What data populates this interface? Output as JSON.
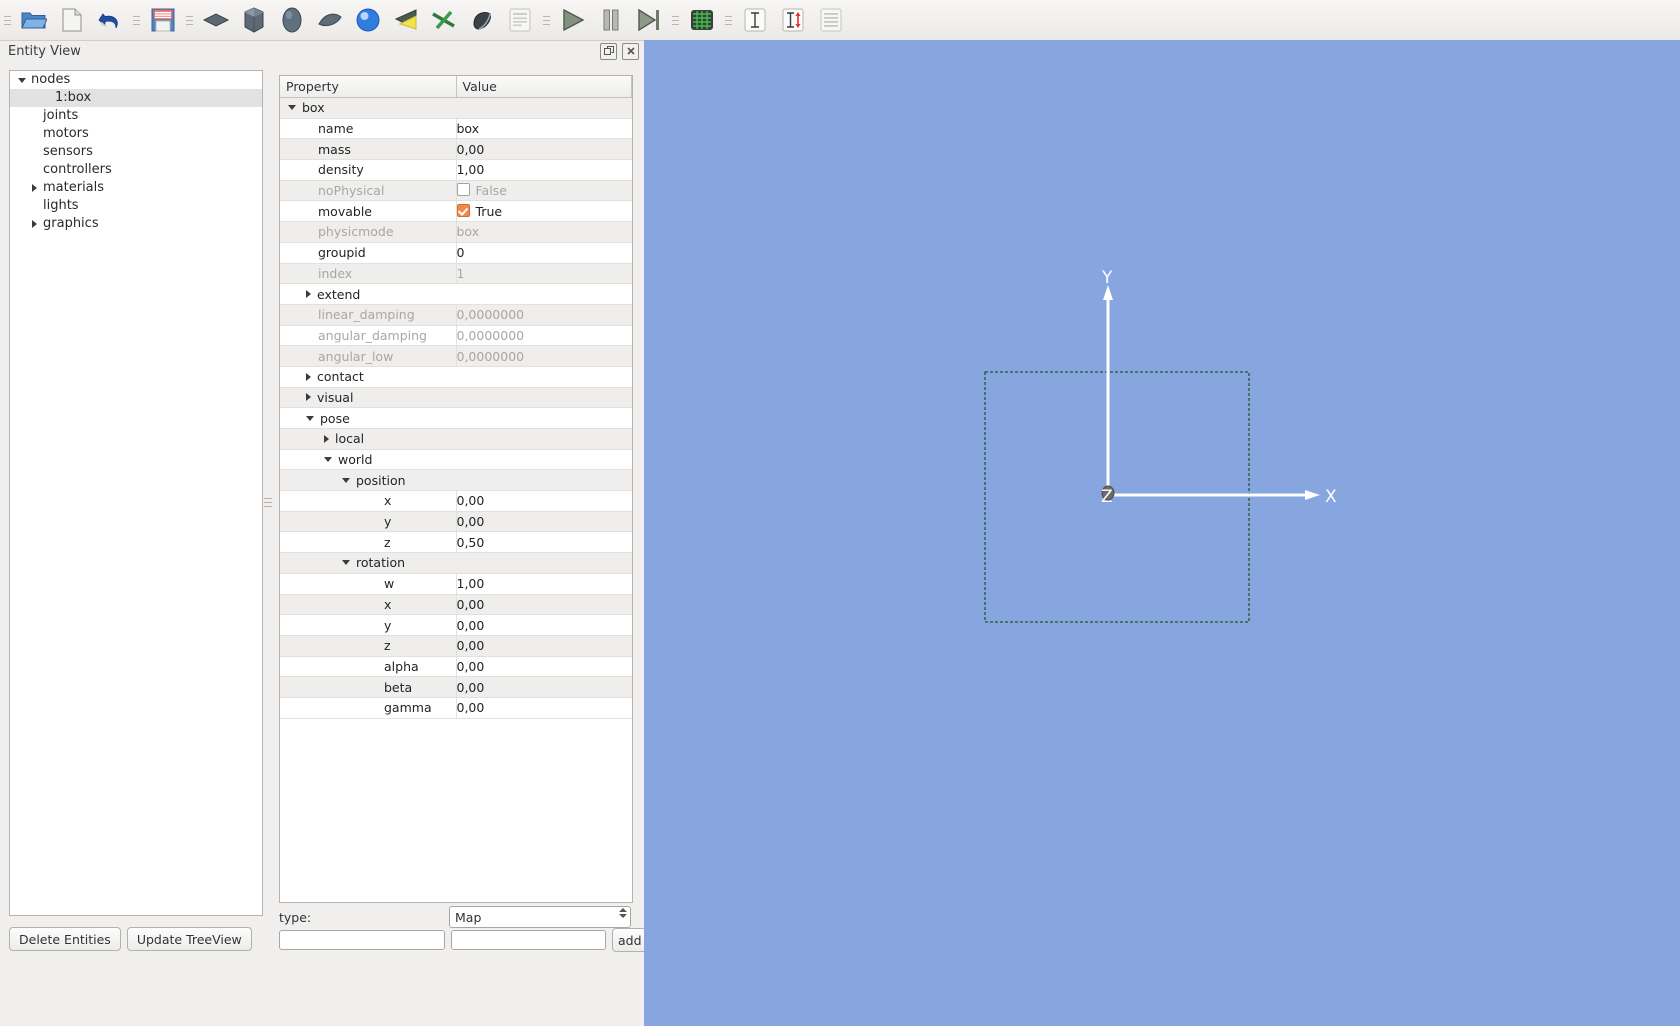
{
  "toolbar": {
    "items": [
      {
        "name": "separator",
        "icon": "separator-grip",
        "label": ""
      },
      {
        "name": "open-file-button",
        "icon": "folder-open-icon",
        "label": "Open"
      },
      {
        "name": "new-file-button",
        "icon": "new-document-icon",
        "label": "New"
      },
      {
        "name": "undo-button",
        "icon": "undo-arrow-icon",
        "label": "Undo"
      },
      {
        "name": "separator",
        "icon": "separator-grip",
        "label": ""
      },
      {
        "name": "save-button",
        "icon": "floppy-save-icon",
        "label": "Save"
      },
      {
        "name": "separator",
        "icon": "separator-grip",
        "label": ""
      },
      {
        "name": "add-plane-button",
        "icon": "plane-primitive-icon",
        "label": "Plane"
      },
      {
        "name": "add-box-button",
        "icon": "box-primitive-icon",
        "label": "Box"
      },
      {
        "name": "add-capsule-button",
        "icon": "capsule-primitive-icon",
        "label": "Capsule"
      },
      {
        "name": "add-cone-button",
        "icon": "cone-primitive-icon",
        "label": "Cone"
      },
      {
        "name": "add-sphere-button",
        "icon": "sphere-primitive-icon",
        "label": "Sphere"
      },
      {
        "name": "add-light-button",
        "icon": "light-cone-icon",
        "label": "Light"
      },
      {
        "name": "add-joint-button",
        "icon": "joint-cross-icon",
        "label": "Joint"
      },
      {
        "name": "add-mesh-button",
        "icon": "mesh-shape-icon",
        "label": "Mesh"
      },
      {
        "name": "document-button",
        "icon": "document-lines-icon",
        "label": "Document"
      },
      {
        "name": "separator",
        "icon": "separator-grip",
        "label": ""
      },
      {
        "name": "play-button",
        "icon": "play-triangle-icon",
        "label": "Play"
      },
      {
        "name": "pause-button",
        "icon": "pause-bars-icon",
        "label": "Pause"
      },
      {
        "name": "step-button",
        "icon": "step-forward-icon",
        "label": "Step"
      },
      {
        "name": "separator",
        "icon": "separator-grip",
        "label": ""
      },
      {
        "name": "console-button",
        "icon": "terminal-grid-icon",
        "label": "Console"
      },
      {
        "name": "separator",
        "icon": "separator-grip",
        "label": ""
      },
      {
        "name": "text-tool-button",
        "icon": "text-cursor-icon",
        "label": "Text"
      },
      {
        "name": "text-import-button",
        "icon": "text-import-icon",
        "label": "Import Text"
      },
      {
        "name": "list-button",
        "icon": "list-lines-icon",
        "label": "List"
      }
    ]
  },
  "dock": {
    "title": "Entity View",
    "float_icon": "float-window-icon",
    "close_icon": "close-x-icon"
  },
  "tree": {
    "items": [
      {
        "label": "nodes",
        "indent": 0,
        "expander": "down",
        "selected": false
      },
      {
        "label": "1:box",
        "indent": 2,
        "expander": "none",
        "selected": true
      },
      {
        "label": "joints",
        "indent": 1,
        "expander": "none",
        "selected": false
      },
      {
        "label": "motors",
        "indent": 1,
        "expander": "none",
        "selected": false
      },
      {
        "label": "sensors",
        "indent": 1,
        "expander": "none",
        "selected": false
      },
      {
        "label": "controllers",
        "indent": 1,
        "expander": "none",
        "selected": false
      },
      {
        "label": "materials",
        "indent": 1,
        "expander": "right",
        "selected": false
      },
      {
        "label": "lights",
        "indent": 1,
        "expander": "none",
        "selected": false
      },
      {
        "label": "graphics",
        "indent": 1,
        "expander": "right",
        "selected": false
      }
    ],
    "delete_button": "Delete Entities",
    "update_button": "Update TreeView"
  },
  "properties": {
    "header": {
      "property": "Property",
      "value": "Value"
    },
    "rows": [
      {
        "kind": "group",
        "label": "box",
        "expander": "down",
        "indent": 0,
        "value": "",
        "dim": false
      },
      {
        "kind": "leaf",
        "label": "name",
        "indent": 1,
        "value": "box",
        "dim": false
      },
      {
        "kind": "leaf",
        "label": "mass",
        "indent": 1,
        "value": "0,00",
        "dim": false
      },
      {
        "kind": "leaf",
        "label": "density",
        "indent": 1,
        "value": "1,00",
        "dim": false
      },
      {
        "kind": "check",
        "label": "noPhysical",
        "indent": 1,
        "value": "False",
        "dim": true,
        "checked": false
      },
      {
        "kind": "check",
        "label": "movable",
        "indent": 1,
        "value": "True",
        "dim": false,
        "checked": true
      },
      {
        "kind": "leaf",
        "label": "physicmode",
        "indent": 1,
        "value": "box",
        "dim": true
      },
      {
        "kind": "leaf",
        "label": "groupid",
        "indent": 1,
        "value": "0",
        "dim": false
      },
      {
        "kind": "leaf",
        "label": "index",
        "indent": 1,
        "value": "1",
        "dim": true
      },
      {
        "kind": "group",
        "label": "extend",
        "expander": "right",
        "indent": 1,
        "value": "",
        "dim": false
      },
      {
        "kind": "leaf",
        "label": "linear_damping",
        "indent": 1,
        "value": "0,0000000",
        "dim": true
      },
      {
        "kind": "leaf",
        "label": "angular_damping",
        "indent": 1,
        "value": "0,0000000",
        "dim": true
      },
      {
        "kind": "leaf",
        "label": "angular_low",
        "indent": 1,
        "value": "0,0000000",
        "dim": true
      },
      {
        "kind": "group",
        "label": "contact",
        "expander": "right",
        "indent": 1,
        "value": "",
        "dim": false
      },
      {
        "kind": "group",
        "label": "visual",
        "expander": "right",
        "indent": 1,
        "value": "",
        "dim": false
      },
      {
        "kind": "group",
        "label": "pose",
        "expander": "down",
        "indent": 1,
        "value": "",
        "dim": false
      },
      {
        "kind": "group",
        "label": "local",
        "expander": "right",
        "indent": 2,
        "value": "",
        "dim": false
      },
      {
        "kind": "group",
        "label": "world",
        "expander": "down",
        "indent": 2,
        "value": "",
        "dim": false
      },
      {
        "kind": "group",
        "label": "position",
        "expander": "down",
        "indent": 3,
        "value": "",
        "dim": false
      },
      {
        "kind": "leaf",
        "label": "x",
        "indent": 4,
        "value": "0,00",
        "dim": false
      },
      {
        "kind": "leaf",
        "label": "y",
        "indent": 4,
        "value": "0,00",
        "dim": false
      },
      {
        "kind": "leaf",
        "label": "z",
        "indent": 4,
        "value": "0,50",
        "dim": false
      },
      {
        "kind": "group",
        "label": "rotation",
        "expander": "down",
        "indent": 3,
        "value": "",
        "dim": false
      },
      {
        "kind": "leaf",
        "label": "w",
        "indent": 4,
        "value": "1,00",
        "dim": false
      },
      {
        "kind": "leaf",
        "label": "x",
        "indent": 4,
        "value": "0,00",
        "dim": false
      },
      {
        "kind": "leaf",
        "label": "y",
        "indent": 4,
        "value": "0,00",
        "dim": false
      },
      {
        "kind": "leaf",
        "label": "z",
        "indent": 4,
        "value": "0,00",
        "dim": false
      },
      {
        "kind": "leaf",
        "label": "alpha",
        "indent": 4,
        "value": "0,00",
        "dim": false
      },
      {
        "kind": "leaf",
        "label": "beta",
        "indent": 4,
        "value": "0,00",
        "dim": false
      },
      {
        "kind": "leaf",
        "label": "gamma",
        "indent": 4,
        "value": "0,00",
        "dim": false
      }
    ]
  },
  "form": {
    "type_label": "type:",
    "type_value": "Map",
    "key_input_value": "",
    "key_input_placeholder": "",
    "value_input_value": "",
    "value_input_placeholder": "",
    "add_button": "add"
  },
  "viewport": {
    "background_color": "#87a6e0",
    "axis_color": "#ffffff",
    "box_outline_color": "#1d5a2a",
    "labels": {
      "x": "X",
      "y": "Y",
      "z": "Z"
    }
  }
}
